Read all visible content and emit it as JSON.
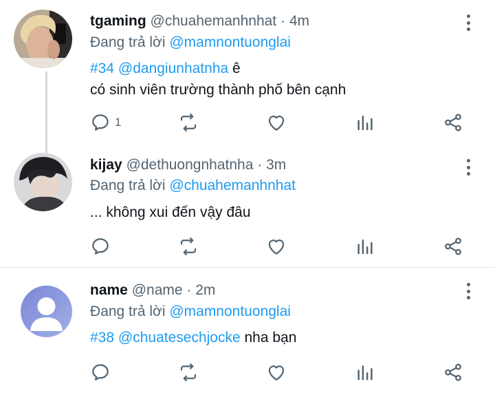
{
  "tweets": [
    {
      "name": "tgaming",
      "handle": "@chuahemanhnhat",
      "dot": "·",
      "time": "4m",
      "reply_prefix": "Đang trả lời",
      "reply_to": "@mamnontuonglai",
      "line1_tag": "#34",
      "line1_mention": "@dangiunhatnha",
      "line1_rest": " ê",
      "line2": "có sinh viên trường thành phố bên cạnh",
      "reply_count": "1",
      "avatar_kind": "photo-blond"
    },
    {
      "name": "kijay",
      "handle": "@dethuongnhatnha",
      "dot": "·",
      "time": "3m",
      "reply_prefix": "Đang trả lời",
      "reply_to": "@chuahemanhnhat",
      "line1": "... không xui đến vậy đâu",
      "reply_count": "",
      "avatar_kind": "photo-dark"
    },
    {
      "name": "name",
      "handle": "@name",
      "dot": "·",
      "time": "2m",
      "reply_prefix": "Đang trả lời",
      "reply_to": "@mamnontuonglai",
      "line1_tag": "#38",
      "line1_mention": "@chuatesechjocke",
      "line1_rest": " nha bạn",
      "reply_count": "",
      "avatar_kind": "default-person"
    }
  ],
  "icons": [
    "reply-icon",
    "retweet-icon",
    "like-icon",
    "views-icon",
    "share-icon",
    "more-icon"
  ],
  "colors": {
    "link": "#1d9bf0",
    "secondary": "#536471",
    "text": "#0f1419",
    "default_avatar_bg": "#8a96d8"
  }
}
